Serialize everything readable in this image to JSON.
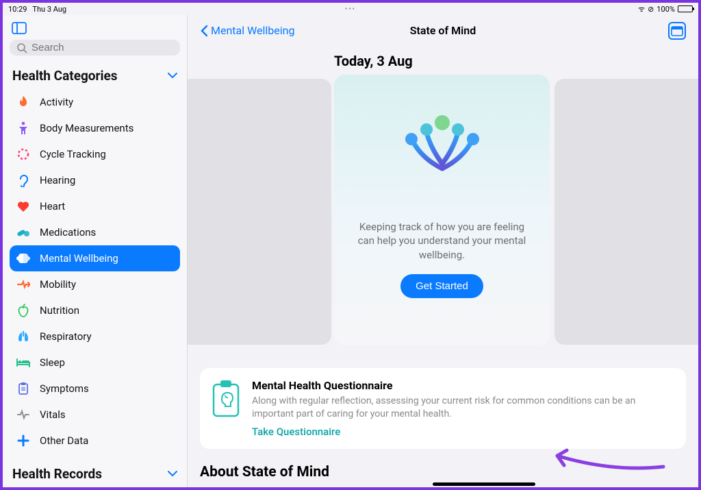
{
  "status": {
    "time": "10:29",
    "date": "Thu 3 Aug",
    "battery_pct": "100%"
  },
  "sidebar": {
    "search_placeholder": "Search",
    "section_title": "Health Categories",
    "records_title": "Health Records",
    "items": [
      {
        "label": "Activity",
        "icon": "flame-icon",
        "color": "c-orange"
      },
      {
        "label": "Body Measurements",
        "icon": "body-icon",
        "color": "c-purple"
      },
      {
        "label": "Cycle Tracking",
        "icon": "cycle-icon",
        "color": "c-pink"
      },
      {
        "label": "Hearing",
        "icon": "ear-icon",
        "color": "c-blue"
      },
      {
        "label": "Heart",
        "icon": "heart-icon",
        "color": "c-red"
      },
      {
        "label": "Medications",
        "icon": "pills-icon",
        "color": "c-teal"
      },
      {
        "label": "Mental Wellbeing",
        "icon": "brain-icon",
        "color": "c-white",
        "selected": true
      },
      {
        "label": "Mobility",
        "icon": "mobility-icon",
        "color": "c-orange"
      },
      {
        "label": "Nutrition",
        "icon": "apple-icon",
        "color": "c-green"
      },
      {
        "label": "Respiratory",
        "icon": "lungs-icon",
        "color": "c-lblue"
      },
      {
        "label": "Sleep",
        "icon": "bed-icon",
        "color": "c-mint"
      },
      {
        "label": "Symptoms",
        "icon": "clipboard-icon",
        "color": "c-indigo"
      },
      {
        "label": "Vitals",
        "icon": "vitals-icon",
        "color": "c-gray"
      },
      {
        "label": "Other Data",
        "icon": "plus-icon",
        "color": "c-blue"
      }
    ]
  },
  "nav": {
    "back_label": "Mental Wellbeing",
    "title": "State of Mind"
  },
  "main": {
    "date_header": "Today, 3 Aug",
    "card_text": "Keeping track of how you are feeling can help you understand your mental wellbeing.",
    "get_started": "Get Started"
  },
  "questionnaire": {
    "title": "Mental Health Questionnaire",
    "desc": "Along with regular reflection, assessing your current risk for common conditions can be an important part of caring for your mental health.",
    "link": "Take Questionnaire"
  },
  "about_header": "About State of Mind"
}
